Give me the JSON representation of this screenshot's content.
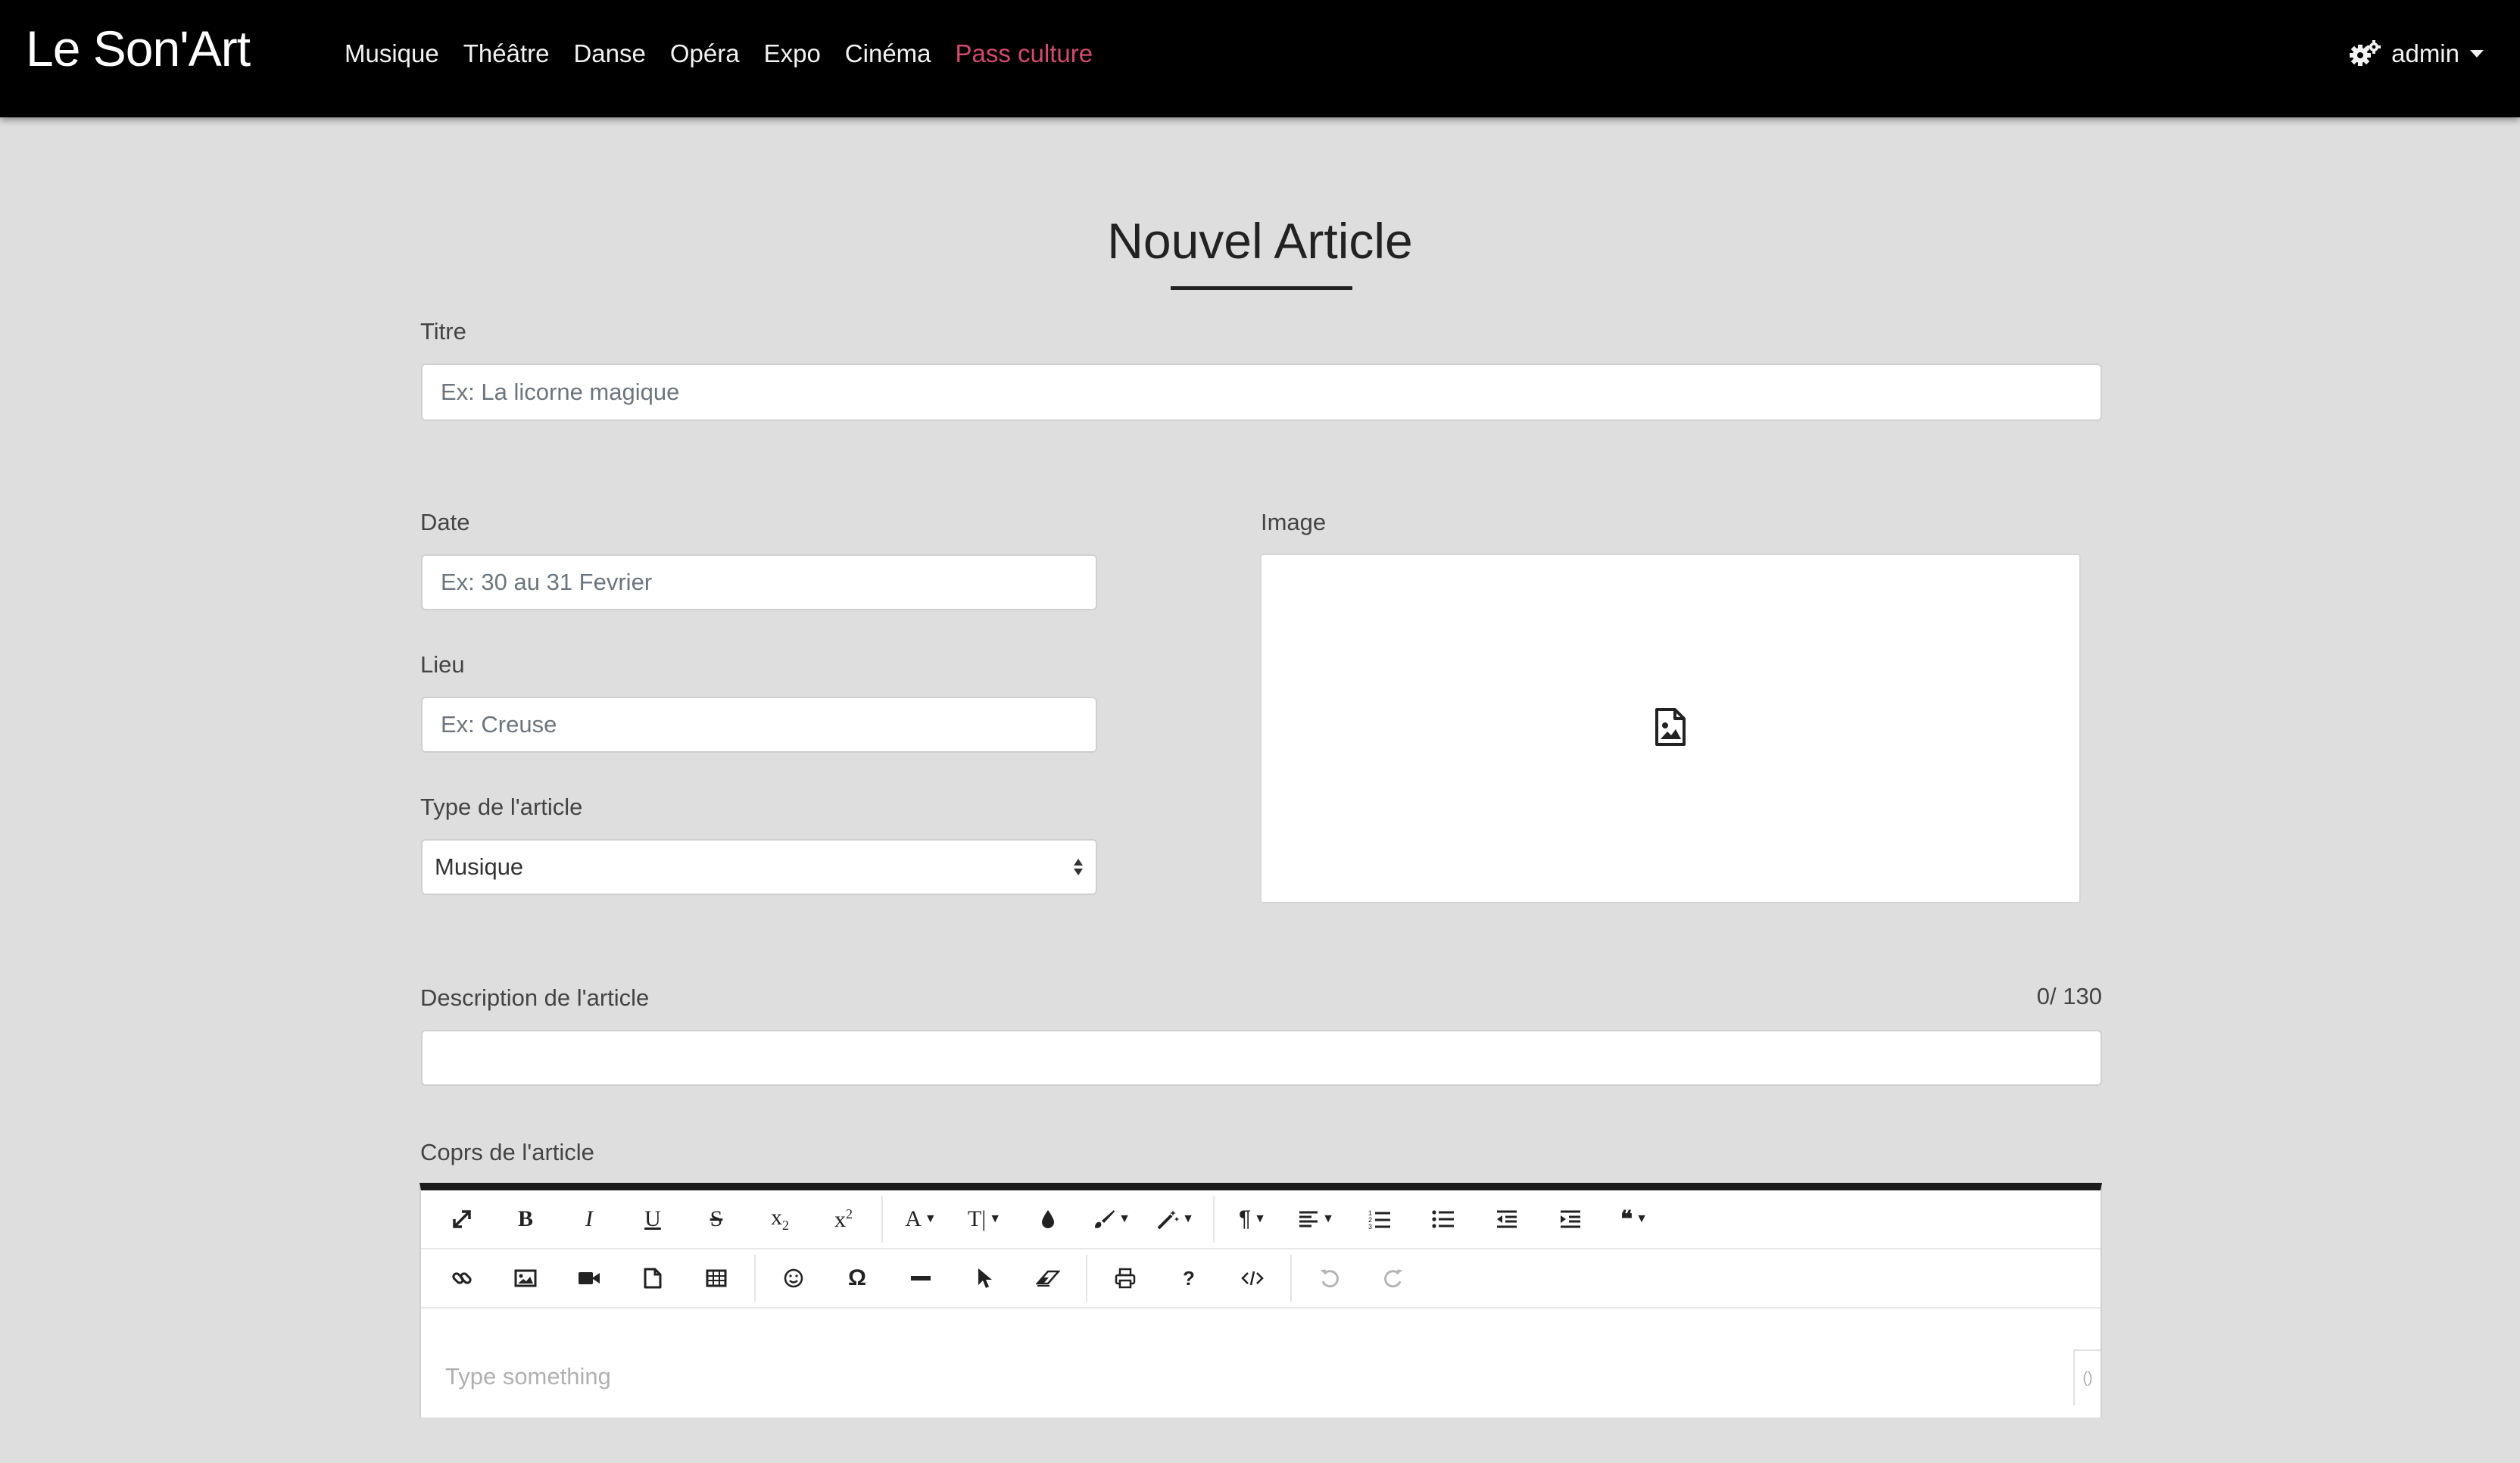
{
  "brand": "Le Son'Art",
  "nav": {
    "links": [
      "Musique",
      "Théâtre",
      "Danse",
      "Opéra",
      "Expo",
      "Cinéma",
      "Pass culture"
    ],
    "accent_color": "#d24a6e",
    "user": "admin"
  },
  "page": {
    "title": "Nouvel Article"
  },
  "form": {
    "titre_label": "Titre",
    "titre_placeholder": "Ex: La licorne magique",
    "date_label": "Date",
    "date_placeholder": "Ex: 30 au 31 Fevrier",
    "lieu_label": "Lieu",
    "lieu_placeholder": "Ex: Creuse",
    "type_label": "Type de l'article",
    "type_value": "Musique",
    "image_label": "Image",
    "description_label": "Description de l'article",
    "description_counter": "0/ 130",
    "corps_label": "Coprs de l'article",
    "editor_placeholder": "Type something",
    "editor_resize_glyph": "()"
  }
}
